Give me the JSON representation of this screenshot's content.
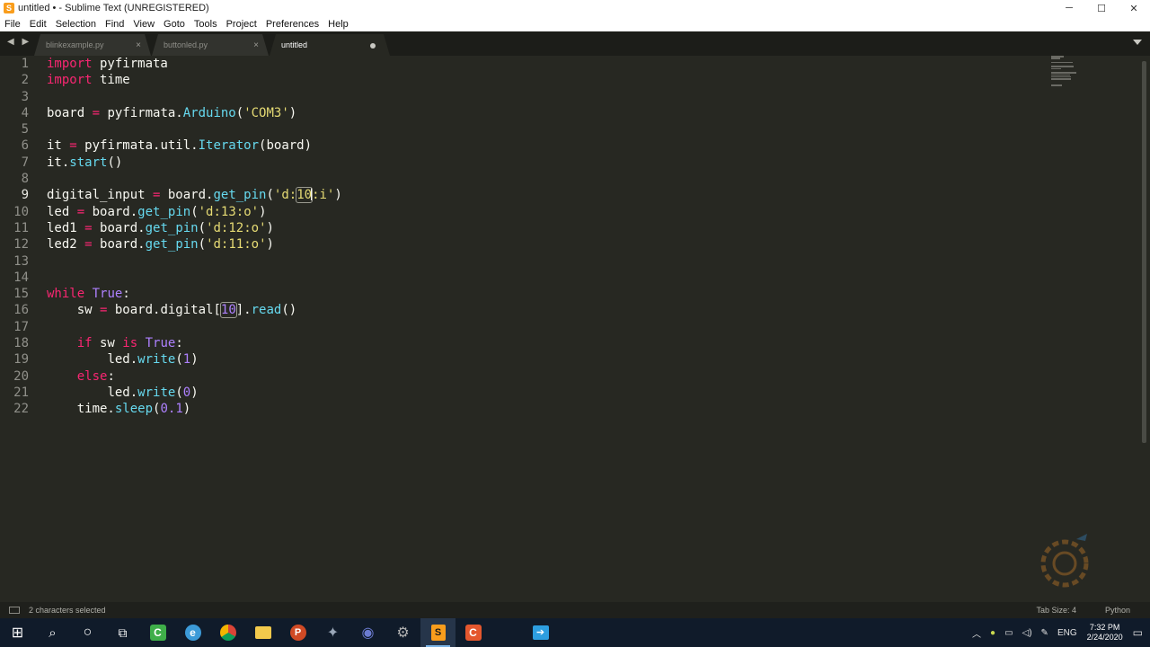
{
  "window": {
    "title": "untitled • - Sublime Text (UNREGISTERED)",
    "controls": {
      "minimize": "─",
      "maximize": "☐",
      "close": "✕"
    }
  },
  "menu": [
    "File",
    "Edit",
    "Selection",
    "Find",
    "View",
    "Goto",
    "Tools",
    "Project",
    "Preferences",
    "Help"
  ],
  "tabs": [
    {
      "label": "blinkexample.py",
      "close": "×",
      "active": false
    },
    {
      "label": "buttonled.py",
      "close": "×",
      "active": false
    },
    {
      "label": "untitled",
      "active": true
    }
  ],
  "tab_nav": "◀ ▶",
  "editor": {
    "line_numbers": [
      "1",
      "2",
      "3",
      "4",
      "5",
      "6",
      "7",
      "8",
      "9",
      "10",
      "11",
      "12",
      "13",
      "14",
      "15",
      "16",
      "17",
      "18",
      "19",
      "20",
      "21",
      "22"
    ],
    "current_line": "9",
    "code": {
      "l1": {
        "kw": "import",
        "rest": " pyfirmata"
      },
      "l2": {
        "kw": "import",
        "rest": " time"
      },
      "l4": {
        "a": "board ",
        "op": "=",
        "b": " pyfirmata.",
        "fn": "Arduino",
        "c": "(",
        "st": "'COM3'",
        "d": ")"
      },
      "l6": {
        "a": "it ",
        "op": "=",
        "b": " pyfirmata.util.",
        "fn": "Iterator",
        "c": "(board)"
      },
      "l7": {
        "a": "it.",
        "fn": "start",
        "c": "()"
      },
      "l9": {
        "a": "digital_input ",
        "op": "=",
        "b": " board.",
        "fn": "get_pin",
        "c": "(",
        "st1": "'d:",
        "sel": "10",
        "st2": ":i'",
        "d": ")"
      },
      "l10": {
        "a": "led ",
        "op": "=",
        "b": " board.",
        "fn": "get_pin",
        "c": "(",
        "st": "'d:13:o'",
        "d": ")"
      },
      "l11": {
        "a": "led1 ",
        "op": "=",
        "b": " board.",
        "fn": "get_pin",
        "c": "(",
        "st": "'d:12:o'",
        "d": ")"
      },
      "l12": {
        "a": "led2 ",
        "op": "=",
        "b": " board.",
        "fn": "get_pin",
        "c": "(",
        "st": "'d:11:o'",
        "d": ")"
      },
      "l15": {
        "kw": "while",
        "sp": " ",
        "nm": "True",
        "rest": ":"
      },
      "l16": {
        "a": "sw ",
        "op": "=",
        "b": " board.digital[",
        "nm": "10",
        "c": "].",
        "fn": "read",
        "d": "()"
      },
      "l18": {
        "kw": "if",
        "b": " sw ",
        "kw2": "is",
        "sp": " ",
        "nm": "True",
        "rest": ":"
      },
      "l19": {
        "a": "led.",
        "fn": "write",
        "c": "(",
        "nm": "1",
        "d": ")"
      },
      "l20": {
        "kw": "else",
        "rest": ":"
      },
      "l21": {
        "a": "led.",
        "fn": "write",
        "c": "(",
        "nm": "0",
        "d": ")"
      },
      "l22": {
        "a": "time.",
        "fn": "sleep",
        "c": "(",
        "nm": "0.1",
        "d": ")"
      }
    }
  },
  "status": {
    "selection": "2 characters selected",
    "tab_size": "Tab Size: 4",
    "syntax": "Python"
  },
  "taskbar": {
    "start": "⊞",
    "search": "⌕",
    "cortana": "○",
    "taskview": "⧉",
    "apps": [
      {
        "name": "camtasia",
        "glyph": "C",
        "color": "#3fae49"
      },
      {
        "name": "edge",
        "glyph": "e",
        "color": "#3c9ad8"
      },
      {
        "name": "chrome",
        "glyph": "●",
        "color": "#e9b62e"
      },
      {
        "name": "explorer",
        "glyph": "▬",
        "color": "#f2c94c"
      },
      {
        "name": "powerpoint",
        "glyph": "P",
        "color": "#d04a25"
      },
      {
        "name": "app-bird",
        "glyph": "✦",
        "color": "#9aa7b8"
      },
      {
        "name": "app-dark",
        "glyph": "◉",
        "color": "#2a3a7a"
      },
      {
        "name": "app-gear",
        "glyph": "⚙",
        "color": "#b0b0b0"
      },
      {
        "name": "sublime",
        "glyph": "S",
        "color": "#f99d1c"
      },
      {
        "name": "app-c",
        "glyph": "C",
        "color": "#e4572e"
      },
      {
        "name": "app-arrow",
        "glyph": "➔",
        "color": "#2d9ee0"
      }
    ],
    "tray": {
      "chevron": "︿",
      "lang": "ENG",
      "time": "7:32 PM",
      "date": "2/24/2020",
      "notification": "▭"
    }
  }
}
